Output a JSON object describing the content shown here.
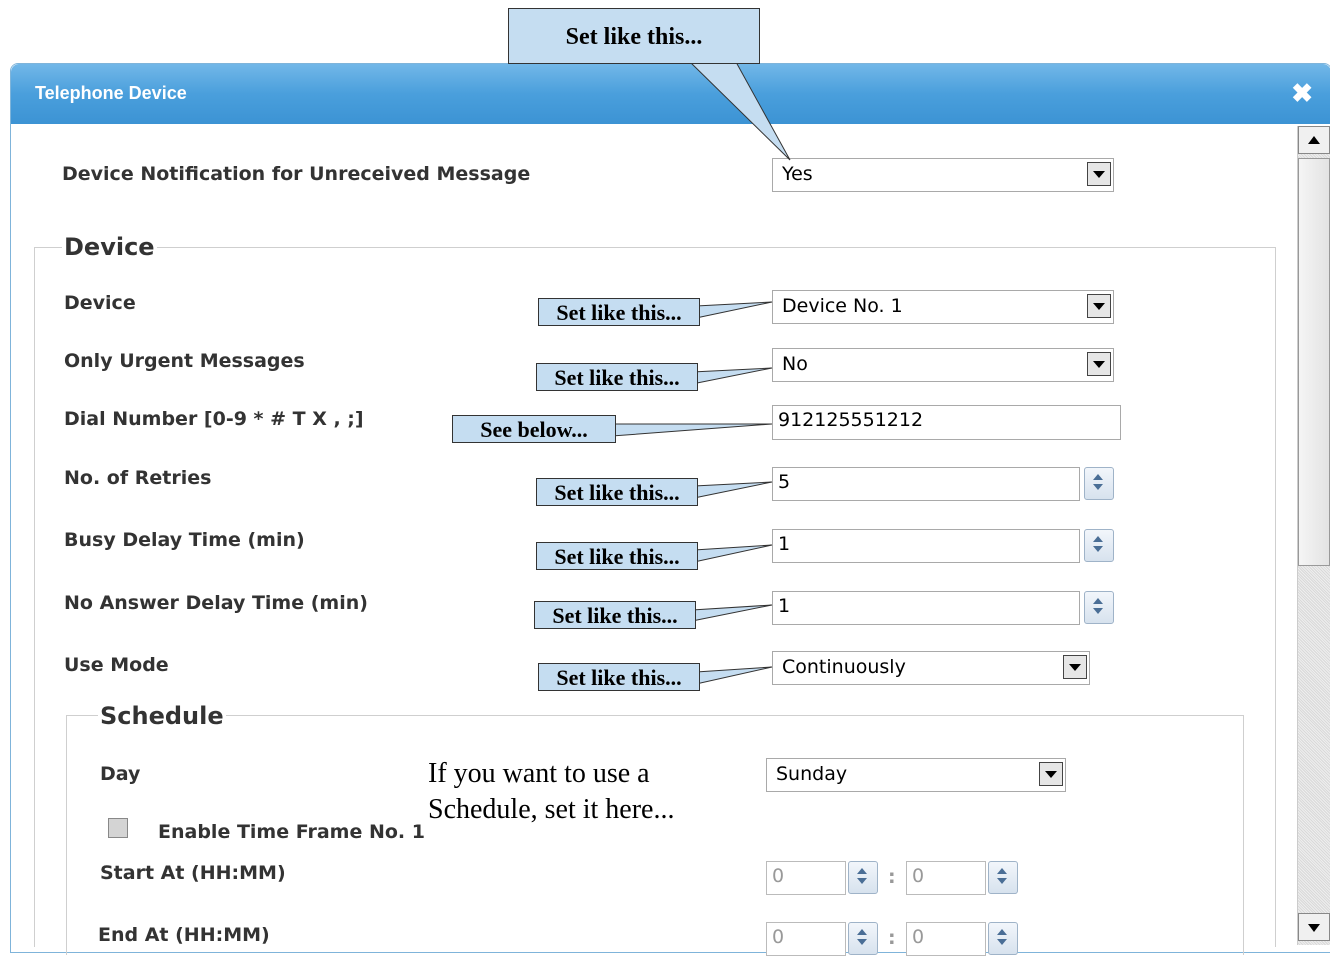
{
  "dialog": {
    "title": "Telephone Device"
  },
  "notification": {
    "label": "Device Notification for Unreceived Message",
    "value": "Yes"
  },
  "device_section": {
    "legend": "Device",
    "device": {
      "label": "Device",
      "value": "Device No. 1"
    },
    "urgent": {
      "label": "Only Urgent Messages",
      "value": "No"
    },
    "dial": {
      "label": "Dial Number [0-9 * # T X , ;]",
      "value": "912125551212"
    },
    "retries": {
      "label": "No. of Retries",
      "value": "5"
    },
    "busy": {
      "label": "Busy Delay Time (min)",
      "value": "1"
    },
    "noanswer": {
      "label": "No Answer Delay Time (min)",
      "value": "1"
    },
    "usemode": {
      "label": "Use Mode",
      "value": "Continuously"
    }
  },
  "schedule": {
    "legend": "Schedule",
    "day": {
      "label": "Day",
      "value": "Sunday"
    },
    "enable_tf1": "Enable Time Frame No. 1",
    "start": {
      "label": "Start At (HH:MM)",
      "hh": "0",
      "mm": "0"
    },
    "end": {
      "label": "End At (HH:MM)",
      "hh": "0",
      "mm": "0"
    },
    "separator": ":"
  },
  "callouts": {
    "top": "Set like this...",
    "device": "Set like this...",
    "urgent": "Set like this...",
    "dial": "See below...",
    "retries": "Set like this...",
    "busy": "Set like this...",
    "noanswer": "Set like this...",
    "usemode": "Set like this...",
    "schedule_note": "If you want to use a Schedule, set it here..."
  }
}
